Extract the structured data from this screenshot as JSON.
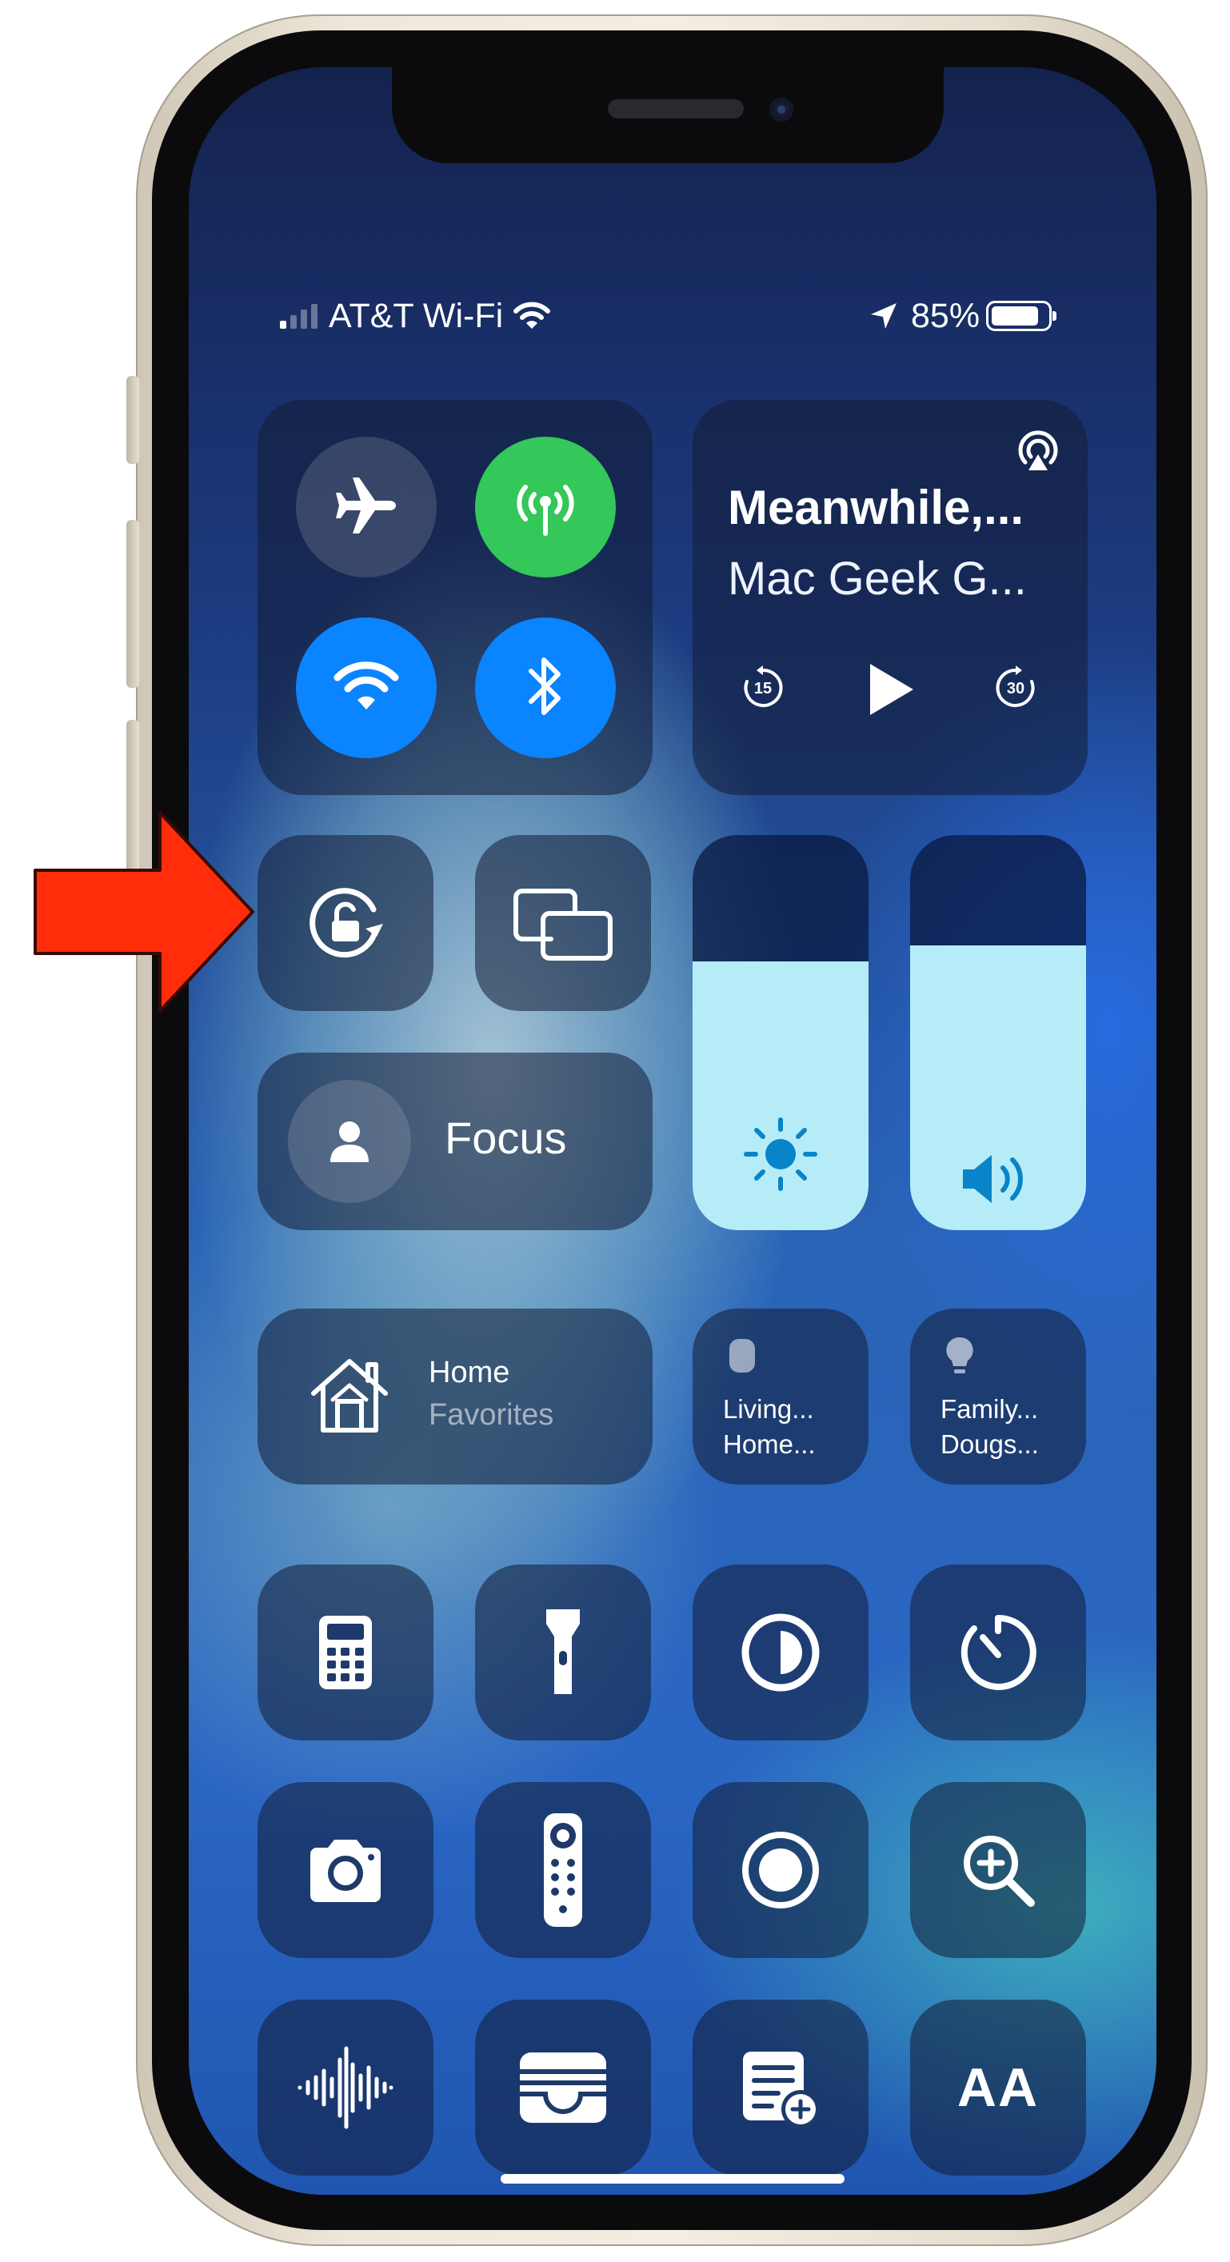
{
  "status_bar": {
    "carrier": "AT&T Wi-Fi",
    "battery_percent": "85%",
    "battery_level": 0.85
  },
  "media": {
    "title": "Meanwhile,...",
    "subtitle": "Mac Geek G...",
    "skip_back_seconds": "15",
    "skip_forward_seconds": "30"
  },
  "focus": {
    "label": "Focus"
  },
  "home": {
    "title": "Home",
    "subtitle": "Favorites"
  },
  "accessories": [
    {
      "line1": "Living...",
      "line2": "Home..."
    },
    {
      "line1": "Family...",
      "line2": "Dougs..."
    }
  ],
  "sliders": {
    "brightness_level": 0.68,
    "volume_level": 0.72
  },
  "text_size_glyph": "AA",
  "colors": {
    "cellular_active": "#34c759",
    "connectivity_active": "#0a84ff",
    "annotation_arrow": "#ff2d0a",
    "slider_fill": "#b6ecf7"
  },
  "annotation": {
    "target": "orientation-lock-button"
  }
}
